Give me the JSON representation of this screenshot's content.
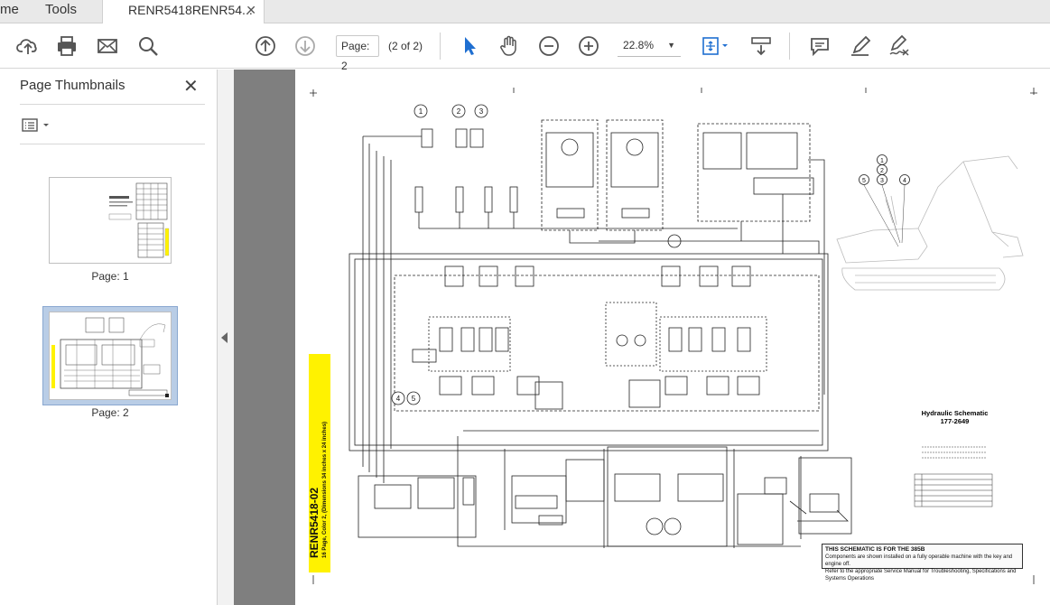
{
  "tabs": {
    "home_label": "me",
    "tools_label": "Tools",
    "document_label": "RENR5418RENR54..."
  },
  "toolbar": {
    "page_input": "Page: 2",
    "page_count": "(2 of 2)",
    "zoom_value": "22.8%"
  },
  "icons": {
    "upload": "upload-cloud-icon",
    "print": "printer-icon",
    "email": "envelope-icon",
    "find": "magnifier-icon",
    "prev_page": "arrow-up-circle-icon",
    "next_page": "arrow-down-circle-icon",
    "select": "cursor-arrow-icon",
    "hand": "hand-icon",
    "zoom_out": "minus-circle-icon",
    "zoom_in": "plus-circle-icon",
    "fit": "fit-page-icon",
    "scroll_mode": "scroll-mode-icon",
    "comment": "comment-icon",
    "highlight": "pen-icon",
    "sign": "sign-icon"
  },
  "sidebar": {
    "title": "Page Thumbnails",
    "thumbnails": [
      {
        "label": "Page: 1"
      },
      {
        "label": "Page: 2"
      }
    ]
  },
  "document": {
    "banner_code": "RENR5418-02",
    "banner_sub": "16 Page, Color 2, (Dimensions 34 inches x 24 inches)",
    "schematic_title": "Hydraulic Schematic",
    "schematic_number": "177-2649",
    "note_line1": "THIS SCHEMATIC IS FOR THE 385B",
    "note_line2": "Components are shown installed on a fully operable machine with the key and engine off.",
    "note_line3": "Refer to the appropriate Service Manual for Troubleshooting, Specifications and Systems Operations",
    "callouts": [
      "1",
      "2",
      "3",
      "4",
      "5"
    ]
  },
  "colors": {
    "accent_blue": "#1f6fd1",
    "banner_yellow": "#fff200",
    "doc_background": "#7f7f7f",
    "selected_thumb": "#b9cde6"
  }
}
